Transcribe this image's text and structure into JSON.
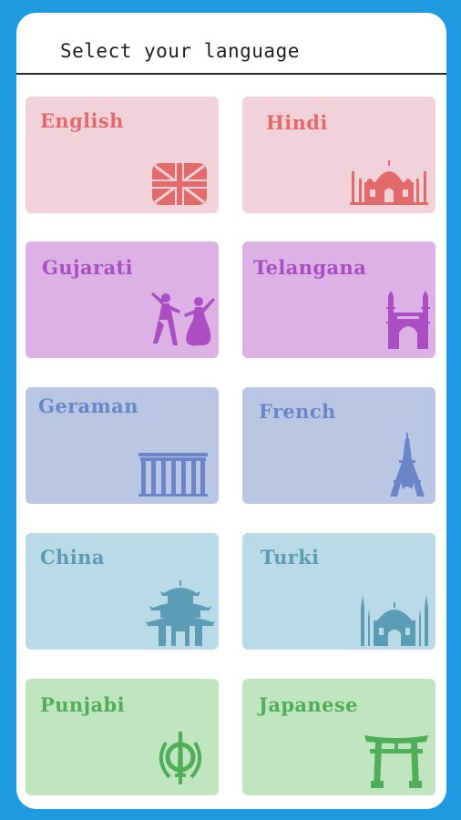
{
  "header": {
    "title": "Select your language"
  },
  "languages": [
    {
      "label": "English",
      "bg": "#f1d2da",
      "fg": "#e36a6a"
    },
    {
      "label": "Hindi",
      "bg": "#f1d2da",
      "fg": "#e36a6a"
    },
    {
      "label": "Gujarati",
      "bg": "#ddb1e5",
      "fg": "#a94fc3"
    },
    {
      "label": "Telangana",
      "bg": "#ddb1e5",
      "fg": "#a94fc3"
    },
    {
      "label": "Geraman",
      "bg": "#b9c6e4",
      "fg": "#6a86c9"
    },
    {
      "label": "French",
      "bg": "#b9c6e4",
      "fg": "#6a86c9"
    },
    {
      "label": "China",
      "bg": "#b9dbe7",
      "fg": "#5c9cb4"
    },
    {
      "label": "Turki",
      "bg": "#b9dbe7",
      "fg": "#5c9cb4"
    },
    {
      "label": "Punjabi",
      "bg": "#bfe6bf",
      "fg": "#4fae57"
    },
    {
      "label": "Japanese",
      "bg": "#bfe6bf",
      "fg": "#4fae57"
    }
  ],
  "icons": [
    "uk-flag-icon",
    "taj-mahal-icon",
    "garba-dancers-icon",
    "charminar-icon",
    "brandenburg-gate-icon",
    "eiffel-tower-icon",
    "pagoda-icon",
    "mosque-icon",
    "khanda-icon",
    "torii-gate-icon"
  ]
}
